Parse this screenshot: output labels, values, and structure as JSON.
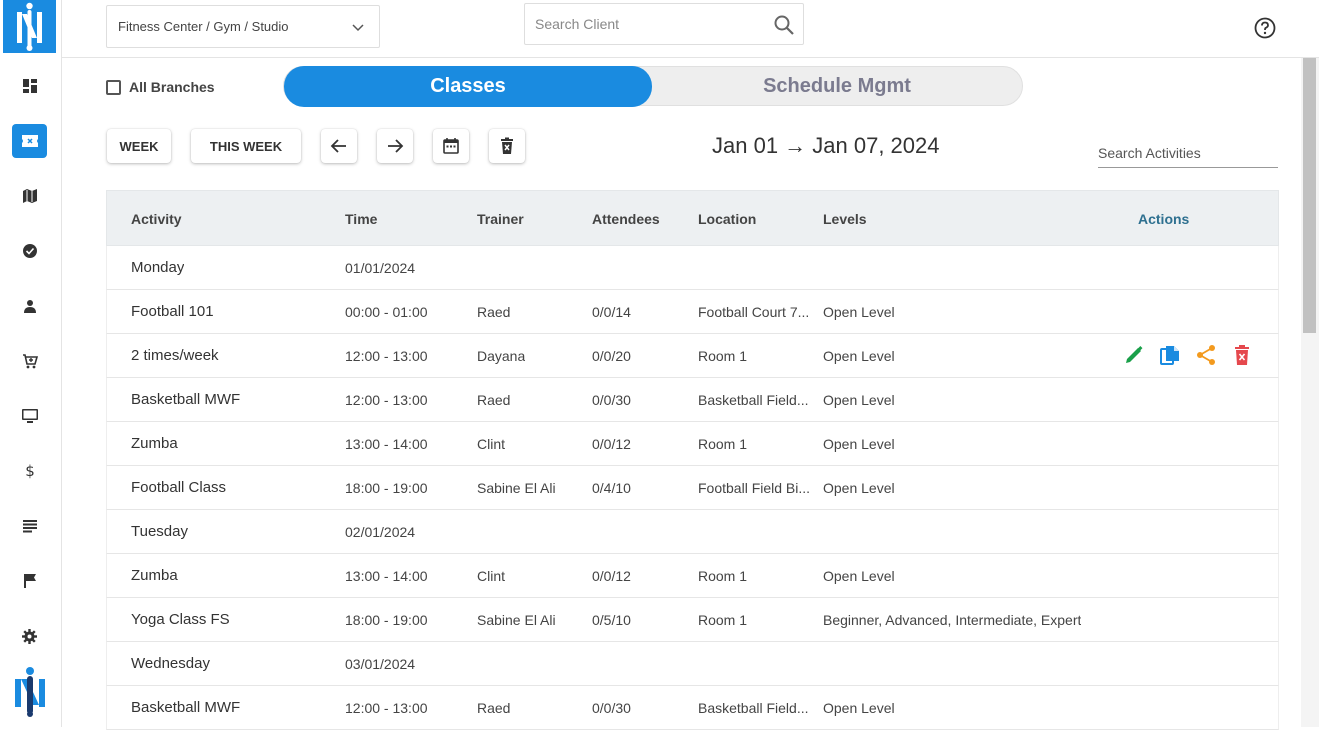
{
  "topbar": {
    "branch_select": "Fitness Center / Gym / Studio",
    "search_placeholder": "Search Client"
  },
  "filters": {
    "all_branches_label": "All Branches",
    "all_branches_checked": false
  },
  "tabs": [
    {
      "label": "Classes",
      "active": true
    },
    {
      "label": "Schedule Mgmt",
      "active": false
    }
  ],
  "toolbar": {
    "week_label": "WEEK",
    "this_week_label": "THIS WEEK",
    "date_range": "Jan 01 → Jan 07, 2024",
    "search_activities_placeholder": "Search Activities"
  },
  "table": {
    "headers": {
      "activity": "Activity",
      "time": "Time",
      "trainer": "Trainer",
      "attendees": "Attendees",
      "location": "Location",
      "levels": "Levels",
      "actions": "Actions"
    },
    "rows": [
      {
        "activity": "Monday",
        "time": "01/01/2024",
        "trainer": "",
        "attendees": "",
        "location": "",
        "levels": "",
        "actions": false
      },
      {
        "activity": "Football 101",
        "time": "00:00 - 01:00",
        "trainer": "Raed",
        "attendees": "0/0/14",
        "location": "Football Court 7...",
        "levels": "Open Level",
        "actions": false
      },
      {
        "activity": "2 times/week",
        "time": "12:00 - 13:00",
        "trainer": "Dayana",
        "attendees": "0/0/20",
        "location": "Room 1",
        "levels": "Open Level",
        "actions": true
      },
      {
        "activity": "Basketball MWF",
        "time": "12:00 - 13:00",
        "trainer": "Raed",
        "attendees": "0/0/30",
        "location": "Basketball Field...",
        "levels": "Open Level",
        "actions": false
      },
      {
        "activity": "Zumba",
        "time": "13:00 - 14:00",
        "trainer": "Clint",
        "attendees": "0/0/12",
        "location": "Room 1",
        "levels": "Open Level",
        "actions": false
      },
      {
        "activity": "Football Class",
        "time": "18:00 - 19:00",
        "trainer": "Sabine El Ali",
        "attendees": "0/4/10",
        "location": "Football Field Bi...",
        "levels": "Open Level",
        "actions": false
      },
      {
        "activity": "Tuesday",
        "time": "02/01/2024",
        "trainer": "",
        "attendees": "",
        "location": "",
        "levels": "",
        "actions": false
      },
      {
        "activity": "Zumba",
        "time": "13:00 - 14:00",
        "trainer": "Clint",
        "attendees": "0/0/12",
        "location": "Room 1",
        "levels": "Open Level",
        "actions": false
      },
      {
        "activity": "Yoga Class FS",
        "time": "18:00 - 19:00",
        "trainer": "Sabine El Ali",
        "attendees": "0/5/10",
        "location": "Room 1",
        "levels": "Beginner, Advanced, Intermediate, Expert",
        "actions": false
      },
      {
        "activity": "Wednesday",
        "time": "03/01/2024",
        "trainer": "",
        "attendees": "",
        "location": "",
        "levels": "",
        "actions": false
      },
      {
        "activity": "Basketball MWF",
        "time": "12:00 - 13:00",
        "trainer": "Raed",
        "attendees": "0/0/30",
        "location": "Basketball Field...",
        "levels": "Open Level",
        "actions": false
      }
    ]
  },
  "sidebar": {
    "items": [
      {
        "icon": "dashboard-icon",
        "active": false
      },
      {
        "icon": "ticket-icon",
        "active": true
      },
      {
        "icon": "map-icon",
        "active": false
      },
      {
        "icon": "check-circle-icon",
        "active": false
      },
      {
        "icon": "person-icon",
        "active": false
      },
      {
        "icon": "cart-icon",
        "active": false
      },
      {
        "icon": "monitor-icon",
        "active": false
      },
      {
        "icon": "dollar-icon",
        "active": false
      },
      {
        "icon": "list-icon",
        "active": false
      },
      {
        "icon": "flag-icon",
        "active": false
      },
      {
        "icon": "gear-icon",
        "active": false
      }
    ]
  },
  "colors": {
    "accent": "#1a8be0",
    "edit": "#1aa04a",
    "copy": "#1a8be0",
    "share": "#f39a1e",
    "delete": "#e5484d"
  }
}
